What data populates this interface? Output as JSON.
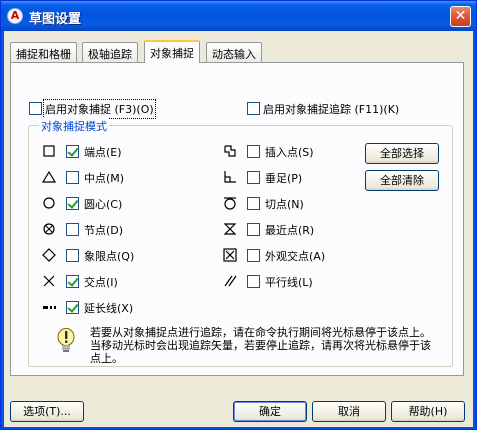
{
  "window": {
    "title": "草图设置",
    "app_icon": "autocad-icon",
    "close_glyph": "✕"
  },
  "tabs": [
    {
      "label": "捕捉和格栅",
      "active": false
    },
    {
      "label": "极轴追踪",
      "active": false
    },
    {
      "label": "对象捕捉",
      "active": true
    },
    {
      "label": "动态输入",
      "active": false
    }
  ],
  "options": {
    "snap_on": {
      "label": "启用对象捕捉 (F3)(O)",
      "checked": false
    },
    "tracking_on": {
      "label": "启用对象捕捉追踪 (F11)(K)",
      "checked": false
    }
  },
  "modes": {
    "group_title": "对象捕捉模式",
    "left": [
      {
        "marker": "square-marker",
        "label": "端点(E)",
        "checked": true
      },
      {
        "marker": "triangle-marker",
        "label": "中点(M)",
        "checked": false
      },
      {
        "marker": "circle-marker",
        "label": "圆心(C)",
        "checked": true
      },
      {
        "marker": "node-marker",
        "label": "节点(D)",
        "checked": false
      },
      {
        "marker": "diamond-marker",
        "label": "象限点(Q)",
        "checked": false
      },
      {
        "marker": "cross-marker",
        "label": "交点(I)",
        "checked": true
      },
      {
        "marker": "extension-marker",
        "label": "延长线(X)",
        "checked": true
      }
    ],
    "right": [
      {
        "marker": "insert-marker",
        "label": "插入点(S)",
        "checked": false
      },
      {
        "marker": "perpendicular-marker",
        "label": "垂足(P)",
        "checked": false
      },
      {
        "marker": "tangent-marker",
        "label": "切点(N)",
        "checked": false
      },
      {
        "marker": "nearest-marker",
        "label": "最近点(R)",
        "checked": false
      },
      {
        "marker": "apparent-intersection-marker",
        "label": "外观交点(A)",
        "checked": false
      },
      {
        "marker": "parallel-marker",
        "label": "平行线(L)",
        "checked": false
      }
    ],
    "select_all": "全部选择",
    "clear_all": "全部清除"
  },
  "info": {
    "icon": "lightbulb-icon",
    "text": "若要从对象捕捉点进行追踪，请在命令执行期间将光标悬停于该点上。当移动光标时会出现追踪矢量，若要停止追踪，请再次将光标悬停于该点上。"
  },
  "footer": {
    "options": "选项(T)...",
    "ok": "确定",
    "cancel": "取消",
    "help": "帮助(H)"
  }
}
